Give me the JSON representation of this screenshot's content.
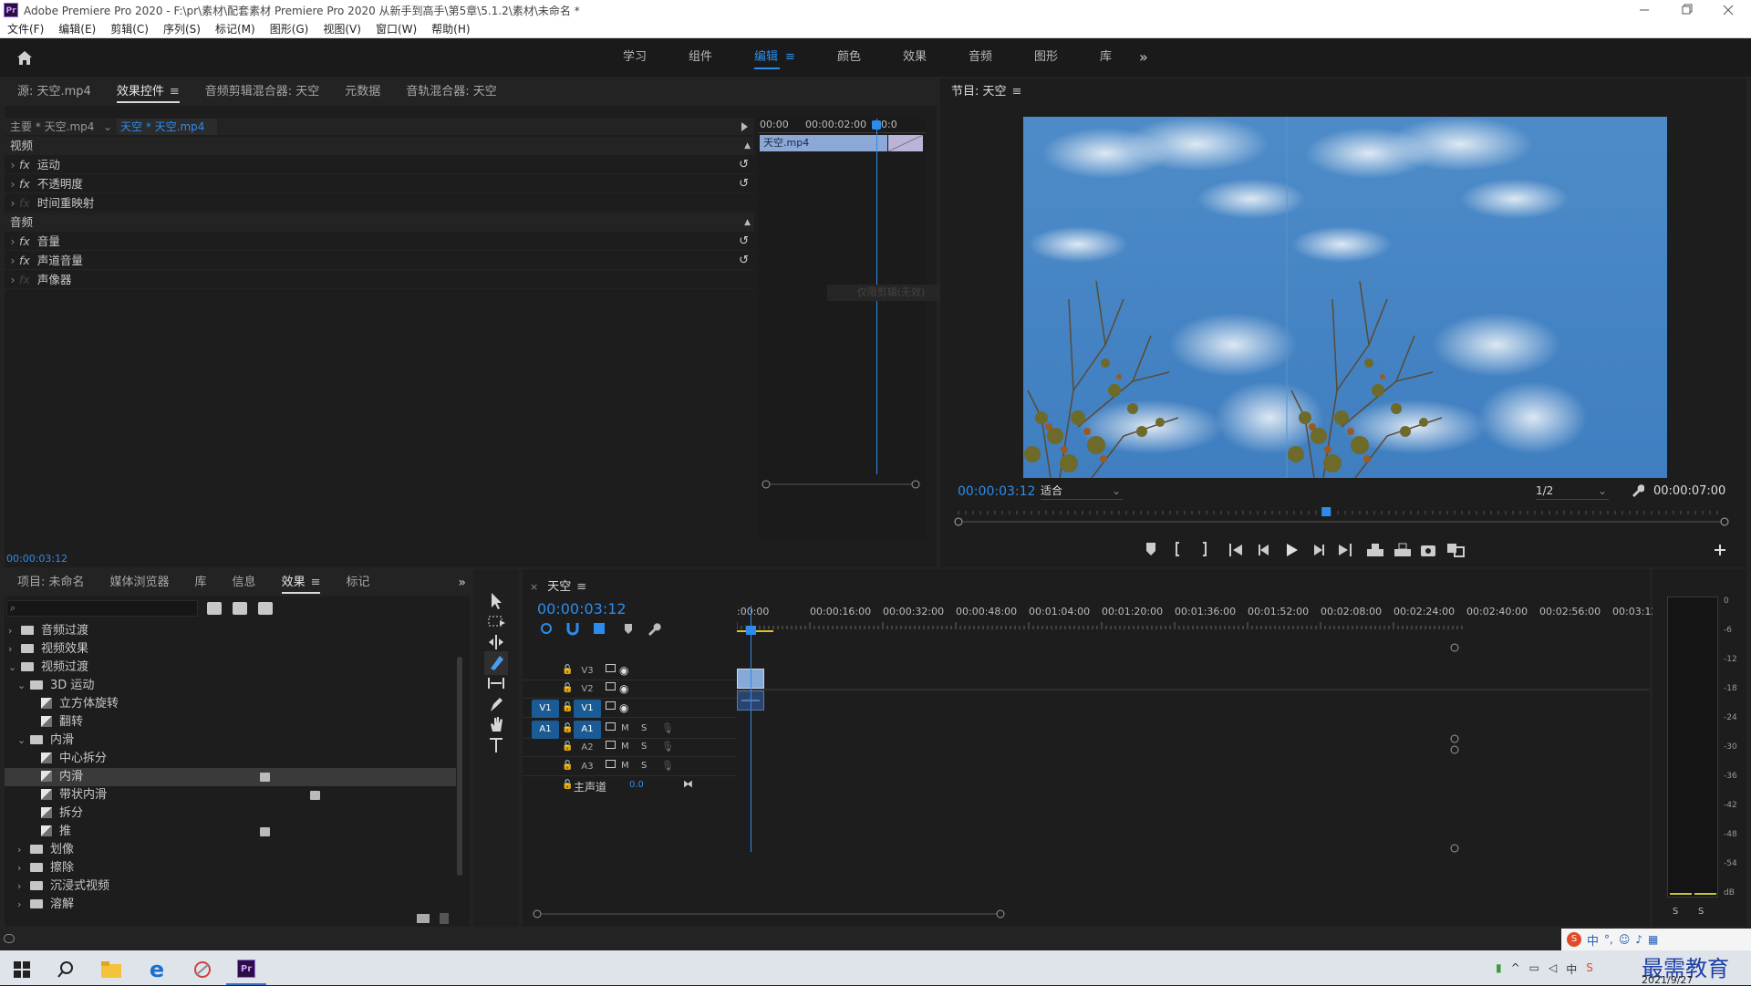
{
  "window": {
    "title": "Adobe Premiere Pro 2020 - F:\\pr\\素材\\配套素材 Premiere Pro 2020 从新手到高手\\第5章\\5.1.2\\素材\\未命名 *",
    "app_badge": "Pr"
  },
  "menu": [
    "文件(F)",
    "编辑(E)",
    "剪辑(C)",
    "序列(S)",
    "标记(M)",
    "图形(G)",
    "视图(V)",
    "窗口(W)",
    "帮助(H)"
  ],
  "workspaces": [
    "学习",
    "组件",
    "编辑",
    "颜色",
    "效果",
    "音频",
    "图形",
    "库"
  ],
  "workspace_active": "编辑",
  "workspace_more": "»",
  "source_panel": {
    "tabs": [
      "源: 天空.mp4",
      "效果控件",
      "音频剪辑混合器: 天空",
      "元数据",
      "音轨混合器: 天空"
    ],
    "master_label": "主要 * 天空.mp4",
    "clip_label": "天空 * 天空.mp4",
    "sections": [
      {
        "name": "视频",
        "items": [
          {
            "label": "运动",
            "fx": true
          },
          {
            "label": "不透明度",
            "fx": true
          },
          {
            "label": "时间重映射",
            "fx": false
          }
        ]
      },
      {
        "name": "音频",
        "items": [
          {
            "label": "音量",
            "fx": true
          },
          {
            "label": "声道音量",
            "fx": true
          },
          {
            "label": "声像器",
            "fx": false
          }
        ]
      }
    ],
    "fx_symbol": "fx",
    "mini_ruler": [
      "00:00",
      "00:00:02:00",
      "00:0"
    ],
    "mini_clip": "天空.mp4",
    "ghost_text": "仅限剪辑(无效)",
    "timecode": "00:00:03:12"
  },
  "program_monitor": {
    "title": "节目: 天空",
    "timecode": "00:00:03:12",
    "fit": "适合",
    "quality": "1/2",
    "duration": "00:00:07:00",
    "playhead_fraction": 0.48
  },
  "project_panel": {
    "tabs": [
      "项目: 未命名",
      "媒体浏览器",
      "库",
      "信息",
      "效果",
      "标记"
    ],
    "active_tab": "效果",
    "tree": [
      {
        "label": "音频过渡",
        "type": "folder",
        "level": 0,
        "open": false
      },
      {
        "label": "视频效果",
        "type": "folder",
        "level": 0,
        "open": false
      },
      {
        "label": "视频过渡",
        "type": "folder",
        "level": 0,
        "open": true
      },
      {
        "label": "3D 运动",
        "type": "folder",
        "level": 1,
        "open": true
      },
      {
        "label": "立方体旋转",
        "type": "item",
        "level": 2
      },
      {
        "label": "翻转",
        "type": "item",
        "level": 2
      },
      {
        "label": "内滑",
        "type": "folder",
        "level": 1,
        "open": true
      },
      {
        "label": "中心拆分",
        "type": "item",
        "level": 2
      },
      {
        "label": "内滑",
        "type": "item",
        "level": 2,
        "selected": true,
        "badge": true
      },
      {
        "label": "带状内滑",
        "type": "item",
        "level": 2,
        "badge": true
      },
      {
        "label": "拆分",
        "type": "item",
        "level": 2
      },
      {
        "label": "推",
        "type": "item",
        "level": 2,
        "badge": true
      },
      {
        "label": "划像",
        "type": "folder",
        "level": 1,
        "open": false
      },
      {
        "label": "擦除",
        "type": "folder",
        "level": 1,
        "open": false
      },
      {
        "label": "沉浸式视频",
        "type": "folder",
        "level": 1,
        "open": false
      },
      {
        "label": "溶解",
        "type": "folder",
        "level": 1,
        "open": false
      }
    ]
  },
  "timeline": {
    "title": "天空",
    "timecode": "00:00:03:12",
    "ruler": [
      ":00:00",
      "00:00:16:00",
      "00:00:32:00",
      "00:00:48:00",
      "00:01:04:00",
      "00:01:20:00",
      "00:01:36:00",
      "00:01:52:00",
      "00:02:08:00",
      "00:02:24:00",
      "00:02:40:00",
      "00:02:56:00",
      "00:03:12:"
    ],
    "video_tracks": [
      "V3",
      "V2",
      "V1"
    ],
    "audio_tracks": [
      "A1",
      "A2",
      "A3"
    ],
    "src_v": "V1",
    "src_a": "A1",
    "m_label": "M",
    "s_label": "S",
    "master_label": "主声道",
    "master_value": "0.0"
  },
  "audio_meter": {
    "scale": [
      "0",
      "-6",
      "-12",
      "-18",
      "-24",
      "-30",
      "-36",
      "-42",
      "-48",
      "-54",
      "dB"
    ],
    "solo": [
      "S",
      "S"
    ]
  },
  "taskbar": {
    "ime": "中",
    "watermark": "最需教育",
    "date": "2021/9/27"
  }
}
